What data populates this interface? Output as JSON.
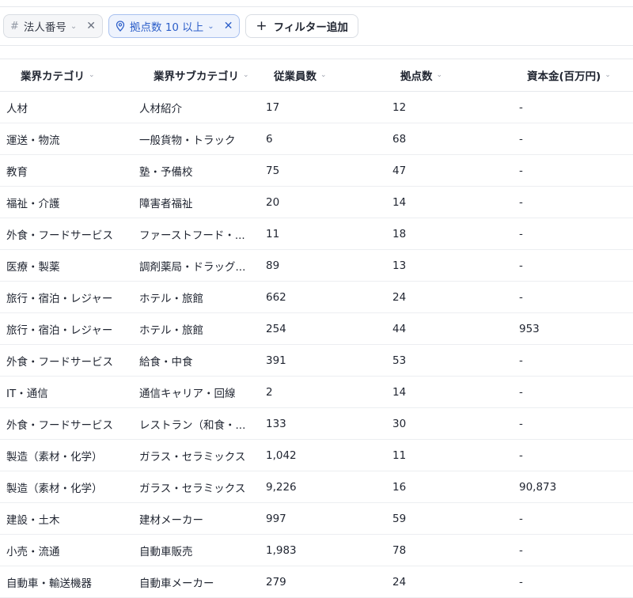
{
  "filters": [
    {
      "icon": "hash-icon",
      "label": "法人番号",
      "active": false
    },
    {
      "icon": "location-pin-icon",
      "label": "拠点数 10 以上",
      "active": true
    }
  ],
  "add_filter_label": "フィルター追加",
  "table": {
    "columns": [
      "業界カテゴリ",
      "業界サブカテゴリ",
      "従業員数",
      "拠点数",
      "資本金(百万円)"
    ],
    "rows": [
      [
        "人材",
        "人材紹介",
        "17",
        "12",
        "-"
      ],
      [
        "運送・物流",
        "一般貨物・トラック",
        "6",
        "68",
        "-"
      ],
      [
        "教育",
        "塾・予備校",
        "75",
        "47",
        "-"
      ],
      [
        "福祉・介護",
        "障害者福祉",
        "20",
        "14",
        "-"
      ],
      [
        "外食・フードサービス",
        "ファーストフード・...",
        "11",
        "18",
        "-"
      ],
      [
        "医療・製薬",
        "調剤薬局・ドラッグ...",
        "89",
        "13",
        "-"
      ],
      [
        "旅行・宿泊・レジャー",
        "ホテル・旅館",
        "662",
        "24",
        "-"
      ],
      [
        "旅行・宿泊・レジャー",
        "ホテル・旅館",
        "254",
        "44",
        "953"
      ],
      [
        "外食・フードサービス",
        "給食・中食",
        "391",
        "53",
        "-"
      ],
      [
        "IT・通信",
        "通信キャリア・回線",
        "2",
        "14",
        "-"
      ],
      [
        "外食・フードサービス",
        "レストラン（和食・...",
        "133",
        "30",
        "-"
      ],
      [
        "製造（素材・化学）",
        "ガラス・セラミックス",
        "1,042",
        "11",
        "-"
      ],
      [
        "製造（素材・化学）",
        "ガラス・セラミックス",
        "9,226",
        "16",
        "90,873"
      ],
      [
        "建設・土木",
        "建材メーカー",
        "997",
        "59",
        "-"
      ],
      [
        "小売・流通",
        "自動車販売",
        "1,983",
        "78",
        "-"
      ],
      [
        "自動車・輸送機器",
        "自動車メーカー",
        "279",
        "24",
        "-"
      ]
    ]
  }
}
